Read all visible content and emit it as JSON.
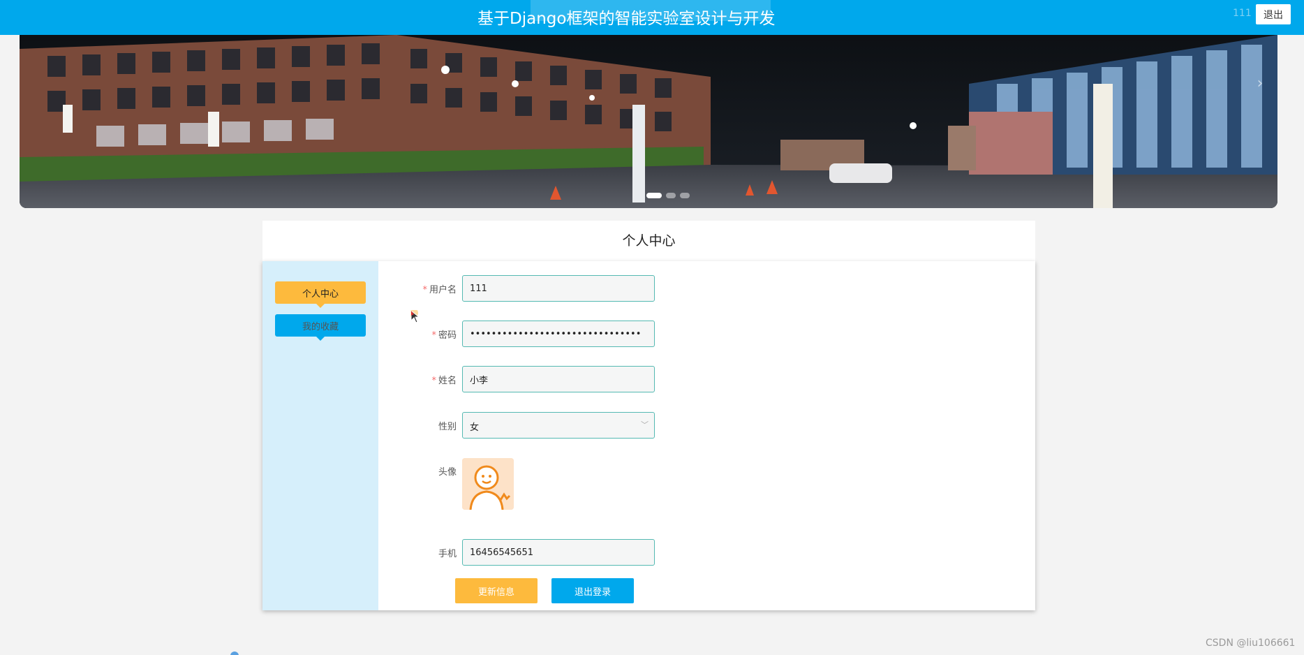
{
  "header": {
    "title": "基于Django框架的智能实验室设计与开发",
    "user": "111",
    "logout_label": "退出",
    "bg_color": "#00a8ec"
  },
  "banner": {
    "slide_count": 3,
    "active_slide": 1
  },
  "page": {
    "title": "个人中心"
  },
  "sidebar": {
    "items": [
      {
        "label": "个人中心",
        "color": "#fdba3d"
      },
      {
        "label": "我的收藏",
        "color": "#00a8ec"
      }
    ]
  },
  "form": {
    "username": {
      "label": "用户名",
      "required": true,
      "value": "111"
    },
    "password": {
      "label": "密码",
      "required": true,
      "value": "••••••••••••••••••••••••••••••••"
    },
    "name": {
      "label": "姓名",
      "required": true,
      "value": "小李"
    },
    "gender": {
      "label": "性别",
      "required": false,
      "value": "女"
    },
    "avatar": {
      "label": "头像"
    },
    "phone": {
      "label": "手机",
      "required": false,
      "value": "16456545651"
    }
  },
  "actions": {
    "update_label": "更新信息",
    "logout_label": "退出登录"
  },
  "watermark": "CSDN @liu106661"
}
